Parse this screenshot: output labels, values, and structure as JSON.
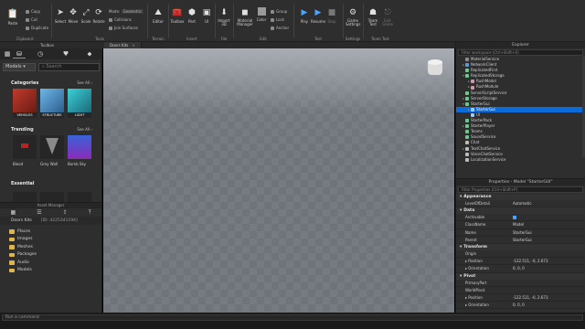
{
  "ribbon": {
    "clipboard": {
      "copy": "Copy",
      "cut": "Cut",
      "duplicate": "Duplicate",
      "paste": "Paste",
      "group_label": "Clipboard"
    },
    "tools": {
      "select": "Select",
      "move": "Move",
      "scale": "Scale",
      "rotate": "Rotate",
      "mode_label": "Mode:",
      "mode_value": "Geometric",
      "collisions": "Collisions",
      "join_surfaces": "Join Surfaces",
      "group_label": "Tools"
    },
    "terrain": {
      "editor": "Editor",
      "group_label": "Terrain"
    },
    "insert": {
      "toolbox": "Toolbox",
      "part": "Part",
      "ui": "UI",
      "group_label": "Insert"
    },
    "file": {
      "import3d": "Import 3D",
      "group_label": "File"
    },
    "edit": {
      "material_manager": "Material Manager",
      "color": "Color",
      "group": "Group",
      "lock": "Lock",
      "anchor": "Anchor",
      "group_label": "Edit"
    },
    "test": {
      "play": "Play",
      "resume": "Resume",
      "stop": "Stop",
      "group_label": "Test"
    },
    "settings": {
      "game_settings": "Game Settings",
      "group_label": "Settings"
    },
    "team_test": {
      "team_test": "Team Test",
      "exit_game": "Exit Game",
      "group_label": "Team Test"
    }
  },
  "tabs": {
    "toolbox_title": "Toolbox",
    "viewport_tab": "Doors Kits",
    "explorer_title": "Explorer"
  },
  "toolbox": {
    "dropdown": "Models",
    "search_placeholder": "Search",
    "categories_label": "Categories",
    "see_all": "See All",
    "categories": [
      {
        "label": "VEHICLES",
        "color": "#c23b2b"
      },
      {
        "label": "STRUCTURE",
        "color": "#3d8fd0"
      },
      {
        "label": "LIGHT",
        "color": "#e0b030"
      }
    ],
    "trending_label": "Trending",
    "trending": [
      {
        "label": "Blood"
      },
      {
        "label": "Grey Wall"
      },
      {
        "label": "Bomb Sky"
      }
    ],
    "essential_label": "Essential"
  },
  "asset_manager": {
    "title": "Asset Manager",
    "path_name": "Doors Kits",
    "path_id": "[ID: 4225341194]",
    "folders": [
      "Places",
      "Images",
      "Meshes",
      "Packages",
      "Audio",
      "Models"
    ]
  },
  "explorer": {
    "filter_placeholder": "Filter workspace (Ctrl+Shift+X)",
    "items": [
      {
        "label": "MaterialService",
        "indent": 1,
        "arrow": "",
        "icon": "#8a8a8a"
      },
      {
        "label": "NetworkClient",
        "indent": 1,
        "arrow": "▸",
        "icon": "#5a9bd8"
      },
      {
        "label": "ReplicatedFirst",
        "indent": 1,
        "arrow": "",
        "icon": "#6c8"
      },
      {
        "label": "ReplicatedStorage",
        "indent": 1,
        "arrow": "▾",
        "icon": "#6c8"
      },
      {
        "label": "RushModel",
        "indent": 2,
        "arrow": "▸",
        "icon": "#c9a"
      },
      {
        "label": "RushModule",
        "indent": 2,
        "arrow": "▸",
        "icon": "#c9a"
      },
      {
        "label": "ServerScriptService",
        "indent": 1,
        "arrow": "",
        "icon": "#6c8"
      },
      {
        "label": "ServerStorage",
        "indent": 1,
        "arrow": "▸",
        "icon": "#6c8"
      },
      {
        "label": "StarterGui",
        "indent": 1,
        "arrow": "▾",
        "icon": "#6c8"
      },
      {
        "label": "StarterGui",
        "indent": 2,
        "arrow": "▸",
        "icon": "#9cf",
        "selected": true
      },
      {
        "label": "UI",
        "indent": 2,
        "arrow": "",
        "icon": "#9cf"
      },
      {
        "label": "StarterPack",
        "indent": 1,
        "arrow": "",
        "icon": "#6c8"
      },
      {
        "label": "StarterPlayer",
        "indent": 1,
        "arrow": "▸",
        "icon": "#6c8"
      },
      {
        "label": "Teams",
        "indent": 1,
        "arrow": "",
        "icon": "#6c8"
      },
      {
        "label": "SoundService",
        "indent": 1,
        "arrow": "",
        "icon": "#6c8"
      },
      {
        "label": "Chat",
        "indent": 1,
        "arrow": "",
        "icon": "#bbb"
      },
      {
        "label": "TextChatService",
        "indent": 1,
        "arrow": "▸",
        "icon": "#bbb"
      },
      {
        "label": "VoiceChatService",
        "indent": 1,
        "arrow": "",
        "icon": "#bbb"
      },
      {
        "label": "LocalizationService",
        "indent": 1,
        "arrow": "",
        "icon": "#bbb"
      }
    ]
  },
  "properties": {
    "title": "Properties - Model \"StarterGUI\"",
    "filter_placeholder": "Filter Properties (Ctrl+Shift+P)",
    "sections": [
      {
        "name": "Appearance",
        "rows": [
          {
            "k": "LevelOfDetail",
            "v": "Automatic"
          }
        ]
      },
      {
        "name": "Data",
        "rows": [
          {
            "k": "Archivable",
            "v": "",
            "check": true
          },
          {
            "k": "ClassName",
            "v": "Model"
          },
          {
            "k": "Name",
            "v": "StarterGui"
          },
          {
            "k": "Parent",
            "v": "StarterGui"
          }
        ]
      },
      {
        "name": "Transform",
        "rows": [
          {
            "k": "Origin",
            "v": ""
          },
          {
            "k": "▸ Position",
            "v": "-122.511, -0, 2.673"
          },
          {
            "k": "▸ Orientation",
            "v": "0, 0, 0"
          }
        ]
      },
      {
        "name": "Pivot",
        "rows": [
          {
            "k": "PrimaryPart",
            "v": ""
          },
          {
            "k": "WorldPivot",
            "v": ""
          },
          {
            "k": "▸ Position",
            "v": "-122.511, -0, 2.673"
          },
          {
            "k": "▸ Orientation",
            "v": "0, 0, 0"
          }
        ]
      }
    ]
  },
  "command_bar": {
    "placeholder": "Run a command"
  }
}
